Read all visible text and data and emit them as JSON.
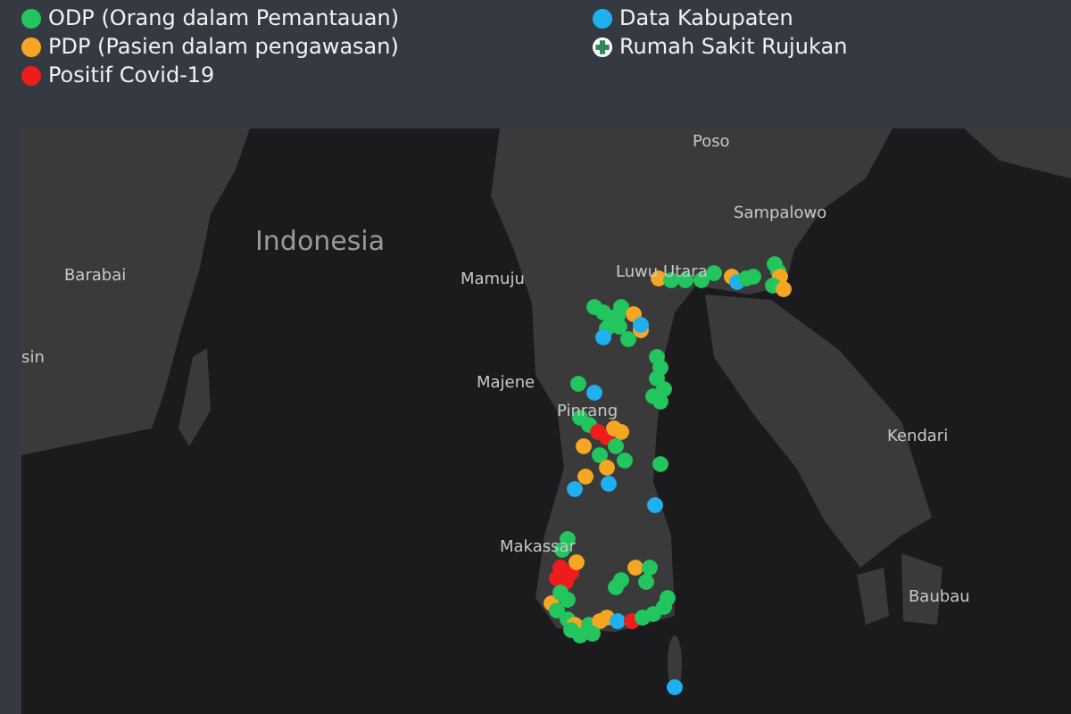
{
  "legend": [
    {
      "kind": "dot",
      "label": "ODP (Orang dalam Pemantauan)",
      "color": "#22c55e"
    },
    {
      "kind": "dot",
      "label": "PDP (Pasien dalam pengawasan)",
      "color": "#f5a623"
    },
    {
      "kind": "dot",
      "label": "Positif Covid-19",
      "color": "#ef1c1c"
    },
    {
      "kind": "dot",
      "label": "Data Kabupaten",
      "color": "#1fb0f0"
    },
    {
      "kind": "hospital",
      "label": "Rumah Sakit Rujukan",
      "color": "#2e8b57"
    }
  ],
  "map": {
    "country_label": "Indonesia",
    "place_labels": [
      "Barabai",
      "sin",
      "Mamuju",
      "Majene",
      "Poso",
      "Sampalowo",
      "Luwu Utara",
      "Pinrang",
      "Makassar",
      "Kendari",
      "Baubau"
    ]
  }
}
